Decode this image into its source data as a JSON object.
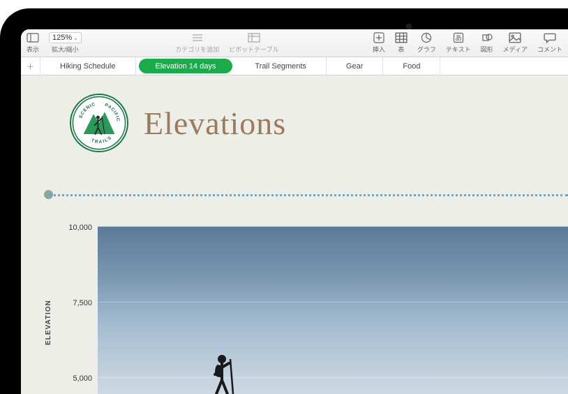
{
  "toolbar": {
    "view": "表示",
    "zoom_value": "125%",
    "zoom_label": "拡大/縮小",
    "add_category": "カテゴリを追加",
    "pivot_table": "ピボットテーブル",
    "insert": "挿入",
    "table": "表",
    "chart": "グラフ",
    "text": "テキスト",
    "shape": "図形",
    "media": "メディア",
    "comment": "コメント"
  },
  "tabs": [
    {
      "label": "Hiking Schedule",
      "active": false
    },
    {
      "label": "Elevation 14 days",
      "active": true
    },
    {
      "label": "Trail Segments",
      "active": false
    },
    {
      "label": "Gear",
      "active": false
    },
    {
      "label": "Food",
      "active": false
    }
  ],
  "page": {
    "title": "Elevations",
    "logo_top": "SCENIC",
    "logo_right": "PACIFIC",
    "logo_bottom": "TRAILS"
  },
  "chart_data": {
    "type": "area",
    "title": "Elevations",
    "xlabel": "",
    "ylabel": "ELEVATION",
    "ylim": [
      0,
      10000
    ],
    "yticks": [
      5000,
      7500,
      10000
    ],
    "ytick_labels": [
      "5,000",
      "7,500",
      "10,000"
    ]
  }
}
